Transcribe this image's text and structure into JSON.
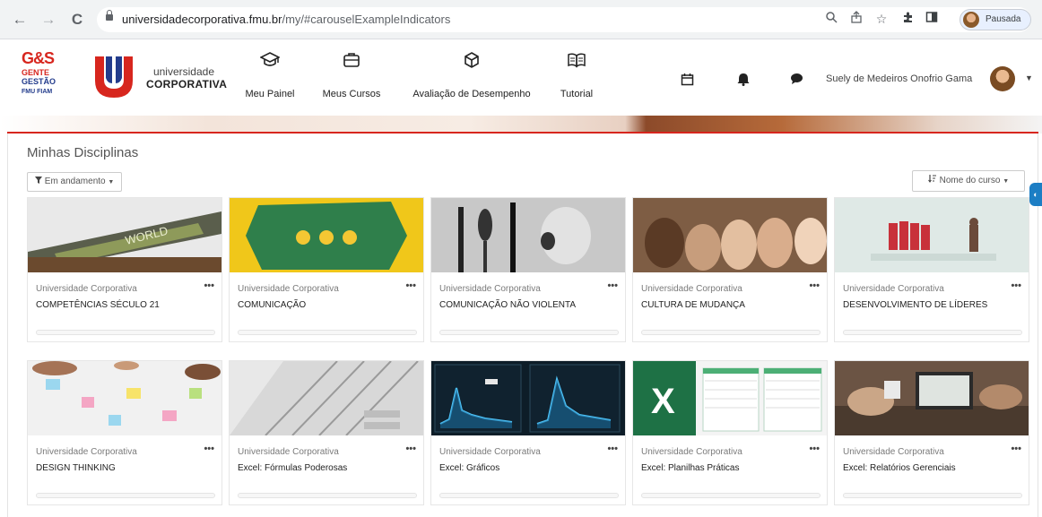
{
  "browser": {
    "back": "←",
    "forward": "→",
    "reload": "C",
    "url_host": "universidadecorporativa.fmu.br",
    "url_path": "/my/#carouselExampleIndicators",
    "profile_label": "Pausada"
  },
  "brand": {
    "gs": "G&S",
    "gente": "GENTE",
    "gestao": "GESTÃO",
    "fmu": "FMU FIAM",
    "univ_line1": "universidade",
    "univ_line2": "CORPORATIVA",
    "u_red": "#d7261e",
    "u_blue": "#233c8c"
  },
  "nav": [
    {
      "label": "Meu Painel",
      "icon": "graduation-cap-icon"
    },
    {
      "label": "Meus Cursos",
      "icon": "briefcase-icon"
    },
    {
      "label": "Avaliação de Desempenho",
      "icon": "cube-icon"
    },
    {
      "label": "Tutorial",
      "icon": "book-icon"
    }
  ],
  "user": {
    "name": "Suely de Medeiros Onofrio Gama"
  },
  "main": {
    "title": "Minhas Disciplinas",
    "filter": "Em andamento",
    "sort": "Nome do curso"
  },
  "courses": [
    {
      "category": "Universidade Corporativa",
      "name": "COMPETÊNCIAS SÉCULO 21",
      "progress": 0
    },
    {
      "category": "Universidade Corporativa",
      "name": "COMUNICAÇÃO",
      "progress": 0
    },
    {
      "category": "Universidade Corporativa",
      "name": "COMUNICAÇÃO NÃO VIOLENTA",
      "progress": 0
    },
    {
      "category": "Universidade Corporativa",
      "name": "CULTURA DE MUDANÇA",
      "progress": 0
    },
    {
      "category": "Universidade Corporativa",
      "name": "DESENVOLVIMENTO DE LÍDERES",
      "progress": 0
    },
    {
      "category": "Universidade Corporativa",
      "name": "DESIGN THINKING",
      "progress": 0
    },
    {
      "category": "Universidade Corporativa",
      "name": "Excel: Fórmulas Poderosas",
      "progress": 0
    },
    {
      "category": "Universidade Corporativa",
      "name": "Excel: Gráficos",
      "progress": 0
    },
    {
      "category": "Universidade Corporativa",
      "name": "Excel: Planilhas Práticas",
      "progress": 0
    },
    {
      "category": "Universidade Corporativa",
      "name": "Excel: Relatórios Gerenciais",
      "progress": 0
    }
  ],
  "card_menu": "•••",
  "excel_letter": "X",
  "world_text": "WORLD"
}
